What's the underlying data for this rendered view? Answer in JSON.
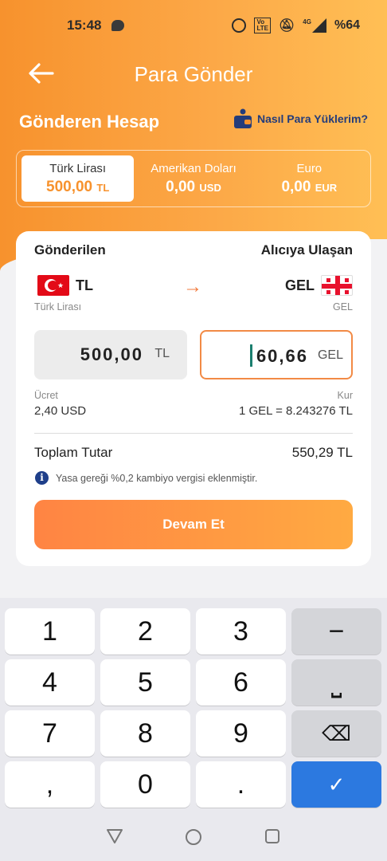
{
  "status": {
    "time": "15:48",
    "battery": "%64",
    "net": "4G",
    "volte": "VoLTE"
  },
  "header": {
    "title": "Para Gönder"
  },
  "section": {
    "title": "Gönderen Hesap",
    "help_label": "Nasıl Para Yüklerim?"
  },
  "accounts": [
    {
      "name": "Türk Lirası",
      "amount": "500,00",
      "currency": "TL",
      "active": true
    },
    {
      "name": "Amerikan Doları",
      "amount": "0,00",
      "currency": "USD",
      "active": false
    },
    {
      "name": "Euro",
      "amount": "0,00",
      "currency": "EUR",
      "active": false
    }
  ],
  "transfer": {
    "sent_label": "Gönderilen",
    "received_label": "Alıcıya Ulaşan",
    "from_code": "TL",
    "from_name": "Türk Lirası",
    "to_code": "GEL",
    "to_name": "GEL",
    "send_amount": "500,00",
    "send_currency": "TL",
    "receive_amount": "60,66",
    "receive_currency": "GEL",
    "fee_label": "Ücret",
    "fee_value": "2,40 USD",
    "rate_label": "Kur",
    "rate_value": "1 GEL = 8.243276 TL",
    "total_label": "Toplam Tutar",
    "total_value": "550,29 TL",
    "info_text": "Yasa gereği %0,2 kambiyo vergisi eklenmiştir.",
    "cta_label": "Devam Et"
  },
  "keypad": {
    "keys": [
      "1",
      "2",
      "3",
      "−",
      "4",
      "5",
      "6",
      "⎵",
      "7",
      "8",
      "9",
      "⌫",
      ",",
      "0",
      ".",
      "✓"
    ]
  },
  "colors": {
    "accent": "#f7922d",
    "cta_start": "#ff8443",
    "cta_end": "#ffaa42",
    "navy": "#243c7a",
    "ok_key": "#2c79e0"
  }
}
